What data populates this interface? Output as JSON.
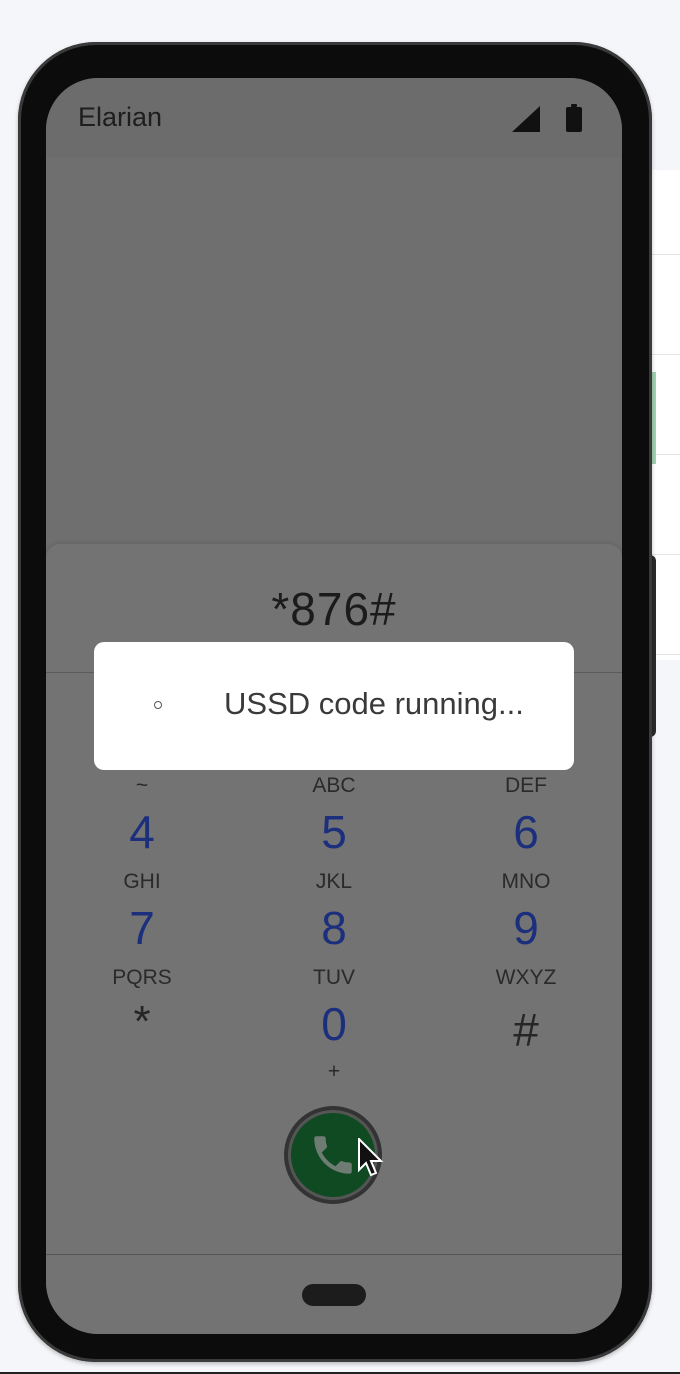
{
  "status_bar": {
    "carrier": "Elarian",
    "signal_icon": "signal-icon",
    "battery_icon": "battery-icon"
  },
  "dialer": {
    "number": "*876#",
    "rows": [
      {
        "letters": [
          "~",
          "ABC",
          "DEF"
        ],
        "digits": [
          "4",
          "5",
          "6"
        ]
      },
      {
        "letters": [
          "GHI",
          "JKL",
          "MNO"
        ],
        "digits": [
          "7",
          "8",
          "9"
        ]
      },
      {
        "letters": [
          "PQRS",
          "TUV",
          "WXYZ"
        ],
        "digits": [
          "*",
          "0",
          "#"
        ]
      }
    ],
    "zero_sub": "+",
    "call_icon": "phone-icon"
  },
  "dialog": {
    "text": "USSD code running...",
    "icon": "spinner-icon"
  },
  "colors": {
    "digit": "#1c2f7d",
    "call_button": "#0f4a22",
    "overlay": "#6f6f6f"
  }
}
